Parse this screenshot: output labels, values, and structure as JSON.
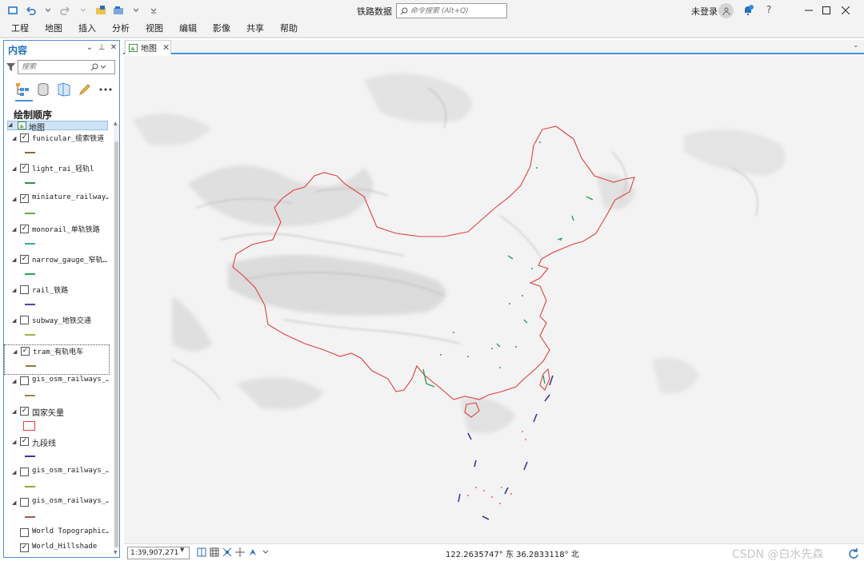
{
  "app": {
    "title": "铁路数据",
    "search_placeholder": "命令搜索 (Alt+Q)",
    "signin": "未登录",
    "help": "?"
  },
  "menu": [
    "工程",
    "地图",
    "插入",
    "分析",
    "视图",
    "编辑",
    "影像",
    "共享",
    "帮助"
  ],
  "contents": {
    "title": "内容",
    "search_placeholder": "搜索",
    "draw_order": "绘制顺序",
    "map_node": "地图",
    "layers": [
      {
        "name": "funicular_缆索铁道",
        "checked": true,
        "color": "#8b6b3a"
      },
      {
        "name": "light_rai_轻轨l",
        "checked": true,
        "color": "#2e8b57"
      },
      {
        "name": "miniature_railway…",
        "checked": true,
        "color": "#6aa84f"
      },
      {
        "name": "monorail_单轨铁路",
        "checked": true,
        "color": "#3aa6a0"
      },
      {
        "name": "narrow_gauge_窄轨…",
        "checked": true,
        "color": "#2e9e5b"
      },
      {
        "name": "rail_铁路",
        "checked": false,
        "color": "#4a4aa8"
      },
      {
        "name": "subway_地铁交通",
        "checked": false,
        "color": "#9ab43a"
      },
      {
        "name": "tram_有轨电车",
        "checked": true,
        "color": "#8b7a3a"
      },
      {
        "name": "gis_osm_railways_…",
        "checked": false,
        "color": "#9a8a3a"
      },
      {
        "name": "国家矢量",
        "checked": true,
        "color": "#e04040"
      },
      {
        "name": "九段线",
        "checked": true,
        "color": "#3a3a9a"
      },
      {
        "name": "gis_osm_railways_…",
        "checked": false,
        "color": "#a0a03a"
      },
      {
        "name": "gis_osm_railways_…",
        "checked": false,
        "color": "#a05a5a"
      },
      {
        "name": "World Topographic…",
        "checked": false,
        "color": ""
      },
      {
        "name": "World_Hillshade",
        "checked": true,
        "color": ""
      }
    ]
  },
  "map_tab": {
    "label": "地图"
  },
  "status": {
    "scale": "1:39,907,271",
    "coords": "122.2635747° 东  36.2833118° 北",
    "watermark": "CSDN @白水先森"
  },
  "colors": {
    "accent": "#4a90d9",
    "boundary": "#e04040",
    "nine_dash": "#3a3a9a",
    "rail_green": "#2e9e5b"
  }
}
